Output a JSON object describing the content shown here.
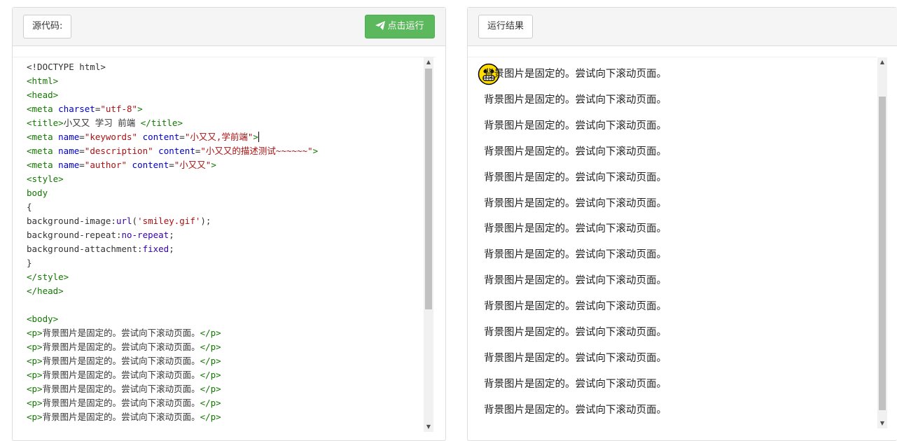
{
  "left_panel": {
    "source_label": "源代码:",
    "run_label": "点击运行"
  },
  "right_panel": {
    "result_label": "运行结果"
  },
  "code_lines": [
    [
      {
        "t": "<!DOCTYPE html>",
        "c": "plain"
      }
    ],
    [
      {
        "t": "<html>",
        "c": "tag"
      }
    ],
    [
      {
        "t": "<head>",
        "c": "tag"
      }
    ],
    [
      {
        "t": "<meta ",
        "c": "tag"
      },
      {
        "t": "charset",
        "c": "attr"
      },
      {
        "t": "=",
        "c": "plain"
      },
      {
        "t": "\"utf-8\"",
        "c": "str"
      },
      {
        "t": ">",
        "c": "tag"
      }
    ],
    [
      {
        "t": "<title>",
        "c": "tag"
      },
      {
        "t": "小又又 学习 前端 ",
        "c": "plain"
      },
      {
        "t": "</title>",
        "c": "tag"
      }
    ],
    [
      {
        "t": "<meta ",
        "c": "tag"
      },
      {
        "t": "name",
        "c": "attr"
      },
      {
        "t": "=",
        "c": "plain"
      },
      {
        "t": "\"keywords\"",
        "c": "str"
      },
      {
        "t": " ",
        "c": "plain"
      },
      {
        "t": "content",
        "c": "attr"
      },
      {
        "t": "=",
        "c": "plain"
      },
      {
        "t": "\"小又又,学前端\"",
        "c": "str"
      },
      {
        "t": ">",
        "c": "tag"
      },
      {
        "t": "",
        "c": "cursor"
      }
    ],
    [
      {
        "t": "<meta ",
        "c": "tag"
      },
      {
        "t": "name",
        "c": "attr"
      },
      {
        "t": "=",
        "c": "plain"
      },
      {
        "t": "\"description\"",
        "c": "str"
      },
      {
        "t": " ",
        "c": "plain"
      },
      {
        "t": "content",
        "c": "attr"
      },
      {
        "t": "=",
        "c": "plain"
      },
      {
        "t": "\"小又又的描述测试~~~~~~\"",
        "c": "str"
      },
      {
        "t": ">",
        "c": "tag"
      }
    ],
    [
      {
        "t": "<meta ",
        "c": "tag"
      },
      {
        "t": "name",
        "c": "attr"
      },
      {
        "t": "=",
        "c": "plain"
      },
      {
        "t": "\"author\"",
        "c": "str"
      },
      {
        "t": " ",
        "c": "plain"
      },
      {
        "t": "content",
        "c": "attr"
      },
      {
        "t": "=",
        "c": "plain"
      },
      {
        "t": "\"小又又\"",
        "c": "str"
      },
      {
        "t": ">",
        "c": "tag"
      }
    ],
    [
      {
        "t": "<style>",
        "c": "tag"
      }
    ],
    [
      {
        "t": "body",
        "c": "tag"
      }
    ],
    [
      {
        "t": "{",
        "c": "plain"
      }
    ],
    [
      {
        "t": "background-image",
        "c": "prop"
      },
      {
        "t": ":",
        "c": "plain"
      },
      {
        "t": "url",
        "c": "kw"
      },
      {
        "t": "(",
        "c": "plain"
      },
      {
        "t": "'smiley.gif'",
        "c": "str"
      },
      {
        "t": ");",
        "c": "plain"
      }
    ],
    [
      {
        "t": "background-repeat",
        "c": "prop"
      },
      {
        "t": ":",
        "c": "plain"
      },
      {
        "t": "no-repeat",
        "c": "kw"
      },
      {
        "t": ";",
        "c": "plain"
      }
    ],
    [
      {
        "t": "background-attachment",
        "c": "prop"
      },
      {
        "t": ":",
        "c": "plain"
      },
      {
        "t": "fixed",
        "c": "kw"
      },
      {
        "t": ";",
        "c": "plain"
      }
    ],
    [
      {
        "t": "}",
        "c": "plain"
      }
    ],
    [
      {
        "t": "</style>",
        "c": "tag"
      }
    ],
    [
      {
        "t": "</head>",
        "c": "tag"
      }
    ],
    [
      {
        "t": "",
        "c": "plain"
      }
    ],
    [
      {
        "t": "<body>",
        "c": "tag"
      }
    ],
    [
      {
        "t": "<p>",
        "c": "tag"
      },
      {
        "t": "背景图片是固定的。尝试向下滚动页面。",
        "c": "plain"
      },
      {
        "t": "</p>",
        "c": "tag"
      }
    ],
    [
      {
        "t": "<p>",
        "c": "tag"
      },
      {
        "t": "背景图片是固定的。尝试向下滚动页面。",
        "c": "plain"
      },
      {
        "t": "</p>",
        "c": "tag"
      }
    ],
    [
      {
        "t": "<p>",
        "c": "tag"
      },
      {
        "t": "背景图片是固定的。尝试向下滚动页面。",
        "c": "plain"
      },
      {
        "t": "</p>",
        "c": "tag"
      }
    ],
    [
      {
        "t": "<p>",
        "c": "tag"
      },
      {
        "t": "背景图片是固定的。尝试向下滚动页面。",
        "c": "plain"
      },
      {
        "t": "</p>",
        "c": "tag"
      }
    ],
    [
      {
        "t": "<p>",
        "c": "tag"
      },
      {
        "t": "背景图片是固定的。尝试向下滚动页面。",
        "c": "plain"
      },
      {
        "t": "</p>",
        "c": "tag"
      }
    ],
    [
      {
        "t": "<p>",
        "c": "tag"
      },
      {
        "t": "背景图片是固定的。尝试向下滚动页面。",
        "c": "plain"
      },
      {
        "t": "</p>",
        "c": "tag"
      }
    ],
    [
      {
        "t": "<p>",
        "c": "tag"
      },
      {
        "t": "背景图片是固定的。尝试向下滚动页面。",
        "c": "plain"
      },
      {
        "t": "</p>",
        "c": "tag"
      }
    ]
  ],
  "result_paragraphs": [
    "背景图片是固定的。尝试向下滚动页面。",
    "背景图片是固定的。尝试向下滚动页面。",
    "背景图片是固定的。尝试向下滚动页面。",
    "背景图片是固定的。尝试向下滚动页面。",
    "背景图片是固定的。尝试向下滚动页面。",
    "背景图片是固定的。尝试向下滚动页面。",
    "背景图片是固定的。尝试向下滚动页面。",
    "背景图片是固定的。尝试向下滚动页面。",
    "背景图片是固定的。尝试向下滚动页面。",
    "背景图片是固定的。尝试向下滚动页面。",
    "背景图片是固定的。尝试向下滚动页面。",
    "背景图片是固定的。尝试向下滚动页面。",
    "背景图片是固定的。尝试向下滚动页面。",
    "背景图片是固定的。尝试向下滚动页面。"
  ],
  "colors": {
    "run_button": "#5cb85c",
    "tag": "#117700",
    "attribute": "#0000cc",
    "string": "#aa1111"
  },
  "icons": {
    "run": "paper-plane-icon",
    "result_background": "smiley-icon"
  }
}
